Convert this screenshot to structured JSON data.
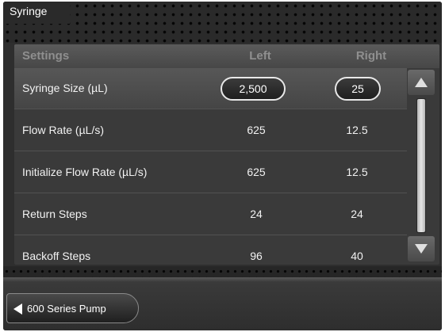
{
  "window": {
    "title": "Syringe"
  },
  "table": {
    "headers": {
      "settings": "Settings",
      "left": "Left",
      "right": "Right"
    },
    "rows": [
      {
        "label": "Syringe Size (µL)",
        "left": "2,500",
        "right": "25"
      },
      {
        "label": "Flow Rate (µL/s)",
        "left": "625",
        "right": "12.5"
      },
      {
        "label": "Initialize Flow Rate (µL/s)",
        "left": "625",
        "right": "12.5"
      },
      {
        "label": "Return Steps",
        "left": "24",
        "right": "24"
      },
      {
        "label": "Backoff Steps",
        "left": "96",
        "right": "40"
      }
    ]
  },
  "footer": {
    "back_label": "600 Series Pump"
  },
  "icons": {
    "scroll_up": "up-arrow-icon",
    "scroll_down": "down-arrow-icon",
    "back": "left-arrow-icon"
  }
}
